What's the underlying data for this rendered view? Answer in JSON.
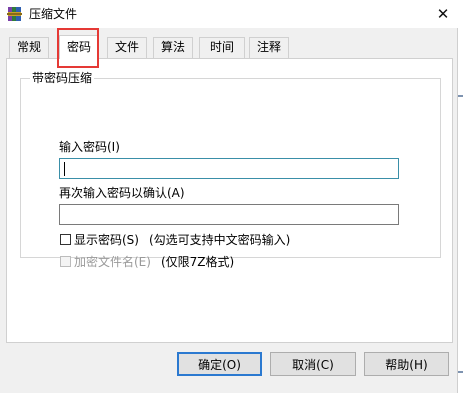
{
  "window": {
    "title": "压缩文件",
    "close_symbol": "✕"
  },
  "tabs": [
    {
      "label": "常规"
    },
    {
      "label": "密码"
    },
    {
      "label": "文件"
    },
    {
      "label": "算法"
    },
    {
      "label": "时间"
    },
    {
      "label": "注释"
    }
  ],
  "active_tab": "密码",
  "group": {
    "title": "带密码压缩",
    "password_label": "输入密码(I)",
    "password_value": "",
    "confirm_label": "再次输入密码以确认(A)",
    "confirm_value": "",
    "show_password_label": "显示密码(S)",
    "show_password_hint": "(勾选可支持中文密码输入)",
    "show_password_checked": false,
    "encrypt_names_label": "加密文件名(E)",
    "encrypt_names_hint": "(仅限7Z格式)",
    "encrypt_names_checked": false,
    "encrypt_names_enabled": false
  },
  "buttons": {
    "ok": "确定(O)",
    "cancel": "取消(C)",
    "help": "帮助(H)"
  },
  "colors": {
    "highlight": "#e53935",
    "default_button_border": "#2b79d0",
    "focus_border": "#3a8fa8"
  },
  "icons": {
    "app": "winrar-books-icon",
    "close": "close-icon"
  }
}
